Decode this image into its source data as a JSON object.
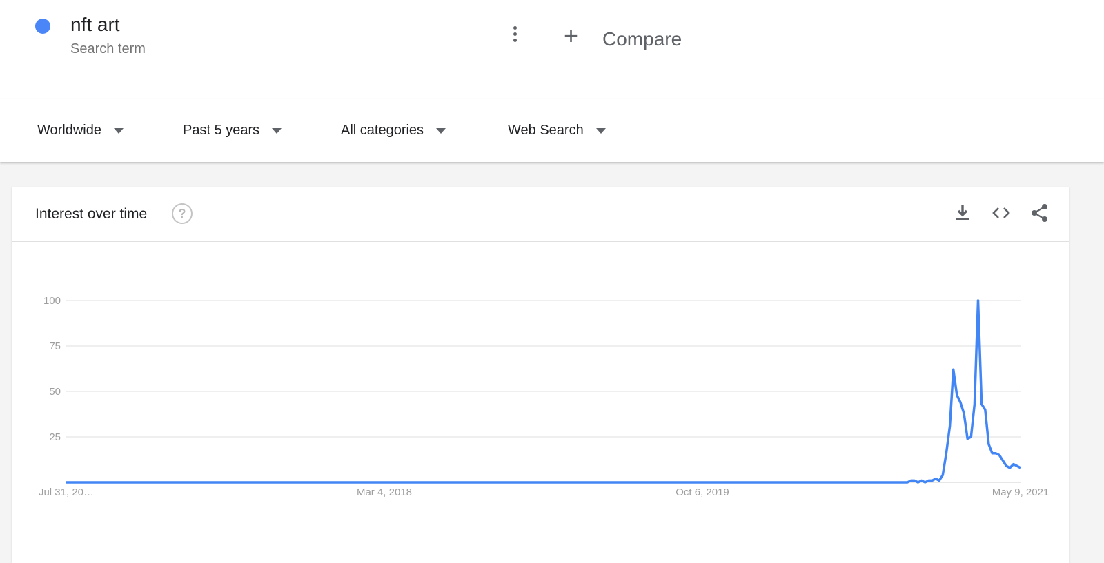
{
  "term": {
    "name": "nft art",
    "subtitle": "Search term",
    "color": "#4a86f7"
  },
  "compare": {
    "label": "Compare",
    "icon": "plus-icon"
  },
  "filters": [
    {
      "label": "Worldwide"
    },
    {
      "label": "Past 5 years"
    },
    {
      "label": "All categories"
    },
    {
      "label": "Web Search"
    }
  ],
  "panel": {
    "title": "Interest over time",
    "help_icon": "?",
    "tools": [
      "download-icon",
      "embed-code-icon",
      "share-icon"
    ]
  },
  "chart_data": {
    "type": "line",
    "line_color": "#4285f4",
    "ylim": [
      0,
      100
    ],
    "y_ticks": [
      25,
      50,
      75,
      100
    ],
    "x_tick_labels": [
      "Jul 31, 20…",
      "Mar 4, 2018",
      "Oct 6, 2019",
      "May 9, 2021"
    ],
    "grid": true,
    "series": [
      {
        "values": [
          0,
          0,
          0,
          0,
          0,
          0,
          0,
          0,
          0,
          0,
          0,
          0,
          0,
          0,
          0,
          0,
          0,
          0,
          0,
          0,
          0,
          0,
          0,
          0,
          0,
          0,
          0,
          0,
          0,
          0,
          0,
          0,
          0,
          0,
          0,
          0,
          0,
          0,
          0,
          0,
          0,
          0,
          0,
          0,
          0,
          0,
          0,
          0,
          0,
          0,
          0,
          0,
          0,
          0,
          0,
          0,
          0,
          0,
          0,
          0,
          0,
          0,
          0,
          0,
          0,
          0,
          0,
          0,
          0,
          0,
          0,
          0,
          0,
          0,
          0,
          0,
          0,
          0,
          0,
          0,
          0,
          0,
          0,
          0,
          0,
          0,
          0,
          0,
          0,
          0,
          0,
          0,
          0,
          0,
          0,
          0,
          0,
          0,
          0,
          0,
          0,
          0,
          0,
          0,
          0,
          0,
          0,
          0,
          0,
          0,
          0,
          0,
          0,
          0,
          0,
          0,
          0,
          0,
          0,
          0,
          0,
          0,
          0,
          0,
          0,
          0,
          0,
          0,
          0,
          0,
          0,
          0,
          0,
          0,
          0,
          0,
          0,
          0,
          0,
          0,
          0,
          0,
          0,
          0,
          0,
          0,
          0,
          0,
          0,
          0,
          0,
          0,
          0,
          0,
          0,
          0,
          0,
          0,
          0,
          0,
          0,
          0,
          0,
          0,
          0,
          0,
          0,
          0,
          0,
          0,
          0,
          0,
          0,
          0,
          0,
          0,
          0,
          0,
          0,
          0,
          0,
          0,
          0,
          0,
          0,
          0,
          0,
          0,
          0,
          0,
          0,
          0,
          0,
          0,
          0,
          0,
          0,
          0,
          0,
          0,
          0,
          0,
          0,
          0,
          0,
          0,
          0,
          0,
          0,
          0,
          0,
          0,
          0,
          0,
          0,
          0,
          0,
          0,
          0,
          0,
          0,
          0,
          0,
          0,
          0,
          0,
          0,
          0,
          0,
          0,
          0,
          0,
          0,
          0,
          0,
          0,
          0,
          0,
          0,
          1,
          1,
          0,
          1,
          0,
          1,
          1,
          2,
          1,
          4,
          16,
          31,
          62,
          48,
          44,
          38,
          24,
          25,
          43,
          100,
          43,
          40,
          21,
          16,
          16,
          15,
          12,
          9,
          8,
          10,
          9,
          8
        ]
      }
    ]
  }
}
